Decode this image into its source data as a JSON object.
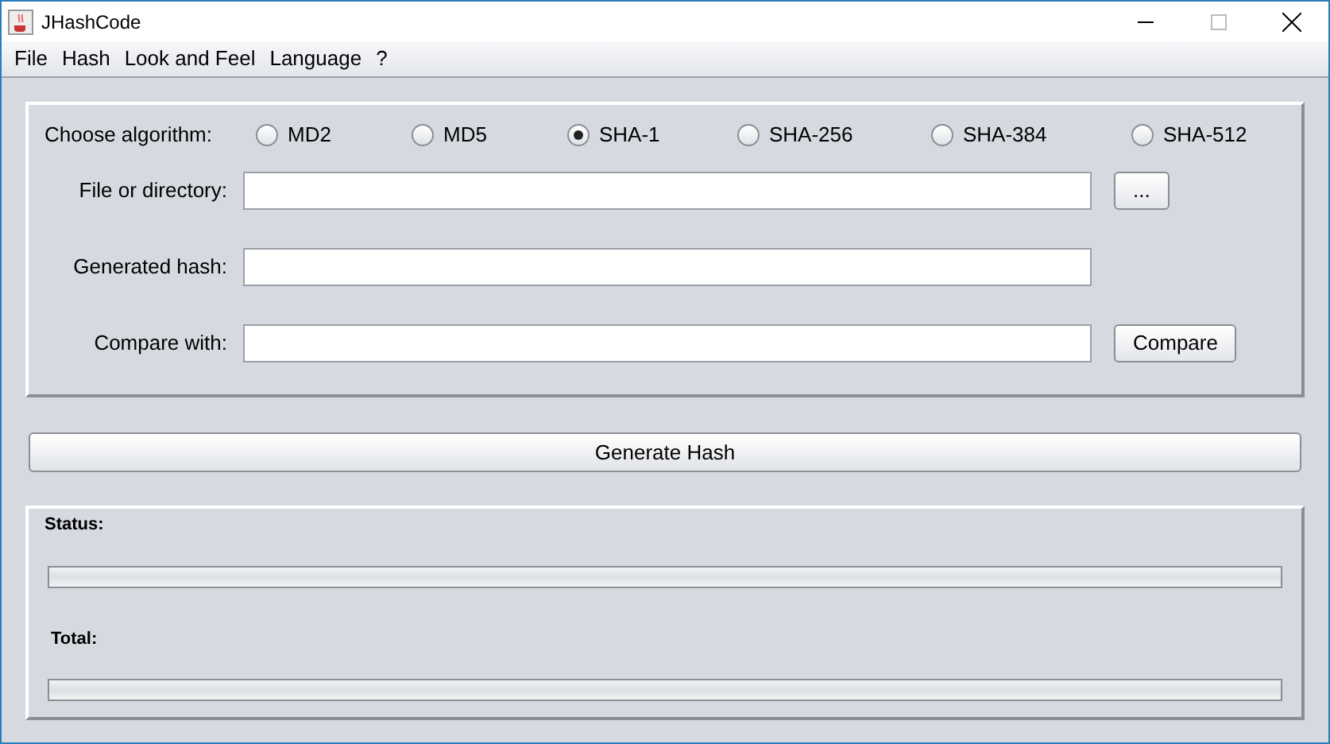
{
  "window": {
    "title": "JHashCode"
  },
  "menu": [
    "File",
    "Hash",
    "Look and Feel",
    "Language",
    "?"
  ],
  "algorithm": {
    "label": "Choose algorithm:",
    "options": [
      {
        "label": "MD2",
        "selected": false
      },
      {
        "label": "MD5",
        "selected": false
      },
      {
        "label": "SHA-1",
        "selected": true
      },
      {
        "label": "SHA-256",
        "selected": false
      },
      {
        "label": "SHA-384",
        "selected": false
      },
      {
        "label": "SHA-512",
        "selected": false
      }
    ]
  },
  "fields": [
    {
      "label": "File or directory:",
      "button": "..."
    },
    {
      "label": "Generated hash:"
    },
    {
      "label": "Compare with:",
      "button": "Compare"
    }
  ],
  "generate_button": "Generate Hash",
  "progress": [
    {
      "label": "Status:"
    },
    {
      "label": "Total:"
    }
  ]
}
